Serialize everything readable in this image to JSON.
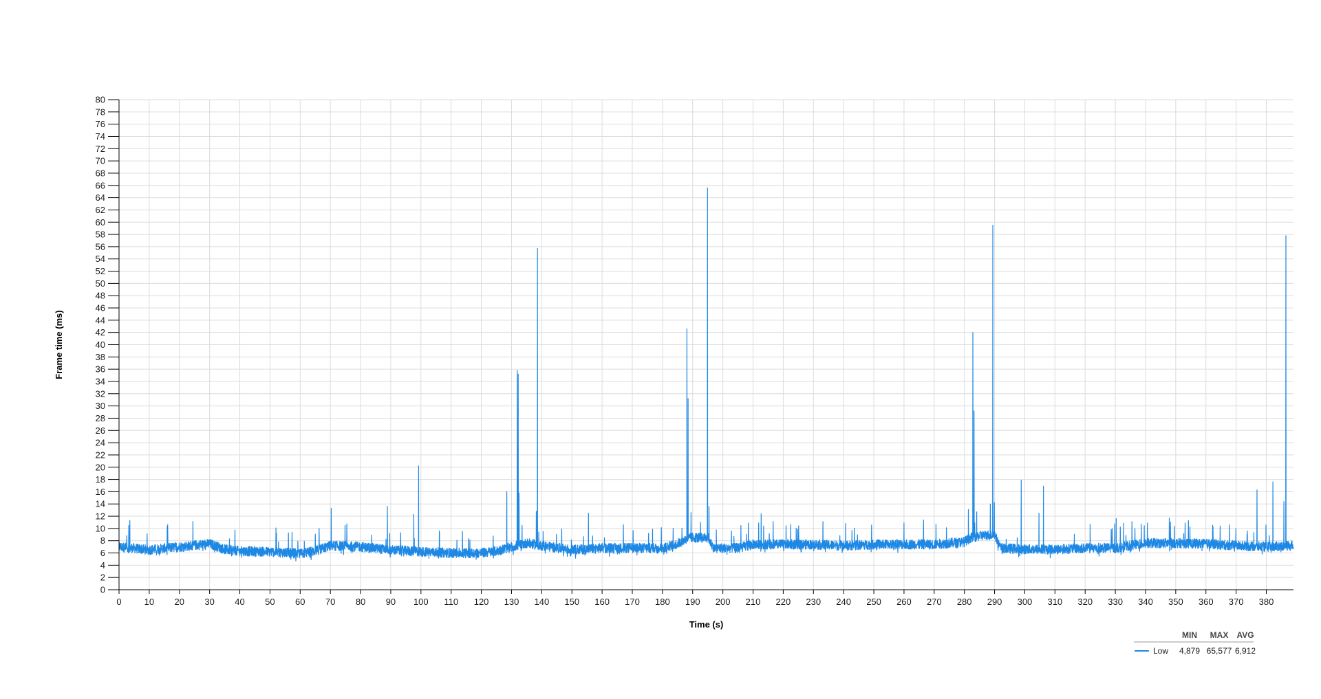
{
  "chart_data": {
    "type": "line",
    "xlabel": "Time (s)",
    "ylabel": "Frame time (ms)",
    "xlim": [
      0,
      389
    ],
    "ylim": [
      0,
      80
    ],
    "x_ticks": [
      0,
      10,
      20,
      30,
      40,
      50,
      60,
      70,
      80,
      90,
      100,
      110,
      120,
      130,
      140,
      150,
      160,
      170,
      180,
      190,
      200,
      210,
      220,
      230,
      240,
      250,
      260,
      270,
      280,
      290,
      300,
      310,
      320,
      330,
      340,
      350,
      360,
      370,
      380
    ],
    "y_ticks": [
      0,
      2,
      4,
      6,
      8,
      10,
      12,
      14,
      16,
      18,
      20,
      22,
      24,
      26,
      28,
      30,
      32,
      34,
      36,
      38,
      40,
      42,
      44,
      46,
      48,
      50,
      52,
      54,
      56,
      58,
      60,
      62,
      64,
      66,
      68,
      70,
      72,
      74,
      76,
      78,
      80
    ],
    "grid": true,
    "colors": {
      "series": "#1e88e5",
      "grid": "#dcdcdc",
      "axis": "#000000"
    },
    "series": [
      {
        "name": "Low",
        "baseline_x": [
          0,
          10,
          20,
          30,
          35,
          40,
          50,
          60,
          65,
          70,
          80,
          90,
          100,
          110,
          120,
          125,
          130,
          135,
          140,
          150,
          160,
          170,
          180,
          185,
          188,
          190,
          195,
          197,
          200,
          205,
          210,
          220,
          230,
          240,
          250,
          260,
          270,
          280,
          282,
          285,
          290,
          292,
          300,
          310,
          320,
          330,
          340,
          350,
          360,
          370,
          380,
          389
        ],
        "baseline_y": [
          7,
          6.5,
          7,
          7.5,
          6.6,
          6.3,
          6.2,
          5.9,
          6.3,
          7.2,
          7,
          6.5,
          6.2,
          6,
          6,
          6.3,
          7,
          7.6,
          7.2,
          6.5,
          6.8,
          6.8,
          6.8,
          7.5,
          8.3,
          8.5,
          8.5,
          6.8,
          6.8,
          6.8,
          7.4,
          7.4,
          7.4,
          7.2,
          7.4,
          7.4,
          7.4,
          7.8,
          8.5,
          8.8,
          9,
          6.8,
          6.6,
          6.6,
          6.8,
          6.8,
          7.6,
          7.6,
          7.5,
          7.2,
          7,
          7.2
        ],
        "spikes_x": [
          3.6,
          70.3,
          88.9,
          97.6,
          99.2,
          128.4,
          131.9,
          132.2,
          132.5,
          138.2,
          138.6,
          155.5,
          188.1,
          188.5,
          189.5,
          194.9,
          195.4,
          212.7,
          266.5,
          281.3,
          282.8,
          283.2,
          288.6,
          289.4,
          289.9,
          298.8,
          304.7,
          306.2,
          330.3,
          347.9,
          376.9,
          382.2,
          385.8,
          386.5
        ],
        "spikes_y": [
          11.3,
          13.3,
          13.6,
          12.3,
          20.2,
          16,
          35.8,
          35.2,
          15.8,
          12.8,
          55.7,
          12.5,
          42.6,
          31.2,
          12.6,
          65.6,
          13.6,
          12.4,
          11.4,
          13.1,
          42,
          29.2,
          14,
          59.5,
          14.2,
          17.9,
          12.5,
          16.9,
          11.6,
          11.7,
          16.3,
          17.6,
          14.4,
          57.8
        ]
      }
    ],
    "legend": {
      "position": "bottom-right",
      "columns": [
        "MIN",
        "MAX",
        "AVG"
      ],
      "rows": [
        {
          "name": "Low",
          "min": "4,879",
          "max": "65,577",
          "avg": "6,912"
        }
      ]
    }
  }
}
